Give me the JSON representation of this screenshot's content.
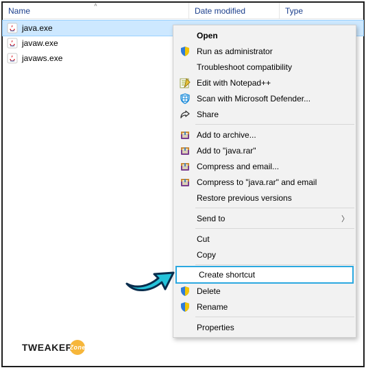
{
  "columns": {
    "name": "Name",
    "date": "Date modified",
    "type": "Type"
  },
  "files": [
    {
      "name": "java.exe",
      "icon": "java-icon",
      "selected": true
    },
    {
      "name": "javaw.exe",
      "icon": "java-icon",
      "selected": false
    },
    {
      "name": "javaws.exe",
      "icon": "java-icon",
      "selected": false
    }
  ],
  "context_menu": [
    {
      "label": "Open",
      "icon": "",
      "bold": true
    },
    {
      "label": "Run as administrator",
      "icon": "shield-icon"
    },
    {
      "label": "Troubleshoot compatibility",
      "icon": ""
    },
    {
      "label": "Edit with Notepad++",
      "icon": "notepadpp-icon"
    },
    {
      "label": "Scan with Microsoft Defender...",
      "icon": "defender-icon"
    },
    {
      "label": "Share",
      "icon": "share-icon"
    },
    {
      "sep": true
    },
    {
      "label": "Add to archive...",
      "icon": "winrar-icon"
    },
    {
      "label": "Add to \"java.rar\"",
      "icon": "winrar-icon"
    },
    {
      "label": "Compress and email...",
      "icon": "winrar-icon"
    },
    {
      "label": "Compress to \"java.rar\" and email",
      "icon": "winrar-icon"
    },
    {
      "label": "Restore previous versions",
      "icon": ""
    },
    {
      "sep": true
    },
    {
      "label": "Send to",
      "icon": "",
      "submenu": true
    },
    {
      "sep": true
    },
    {
      "label": "Cut",
      "icon": ""
    },
    {
      "label": "Copy",
      "icon": ""
    },
    {
      "sep": true
    },
    {
      "label": "Create shortcut",
      "icon": "",
      "hilite": true
    },
    {
      "label": "Delete",
      "icon": "shield-icon"
    },
    {
      "label": "Rename",
      "icon": "shield-icon"
    },
    {
      "sep": true
    },
    {
      "label": "Properties",
      "icon": ""
    }
  ],
  "logo": {
    "text": "TWEAKER",
    "suffix": "Zone"
  }
}
